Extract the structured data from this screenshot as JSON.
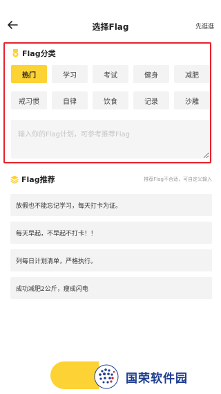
{
  "header": {
    "title": "选择Flag",
    "skip_label": "先逛逛"
  },
  "category": {
    "title": "Flag分类",
    "chips": [
      {
        "label": "热门",
        "active": true
      },
      {
        "label": "学习",
        "active": false
      },
      {
        "label": "考试",
        "active": false
      },
      {
        "label": "健身",
        "active": false
      },
      {
        "label": "减肥",
        "active": false
      },
      {
        "label": "戒习惯",
        "active": false
      },
      {
        "label": "自律",
        "active": false
      },
      {
        "label": "饮食",
        "active": false
      },
      {
        "label": "记录",
        "active": false
      },
      {
        "label": "沙雕",
        "active": false
      }
    ],
    "input_placeholder": "输入你的Flag计划，可参考推荐Flag"
  },
  "recommend": {
    "title": "Flag推荐",
    "hint": "推荐Flag不合适，可自定义输入",
    "items": [
      "放假也不能忘记学习，每天打卡为证。",
      "每天早起，不早起不打卡！！",
      "列每日计划清单，严格执行。",
      "成功减肥2公斤，瘦成闪电"
    ]
  },
  "brand": {
    "text": "国荣软件园"
  },
  "colors": {
    "accent": "#fdd234",
    "highlight_border": "#e8202a",
    "brand": "#1e3d8f"
  }
}
